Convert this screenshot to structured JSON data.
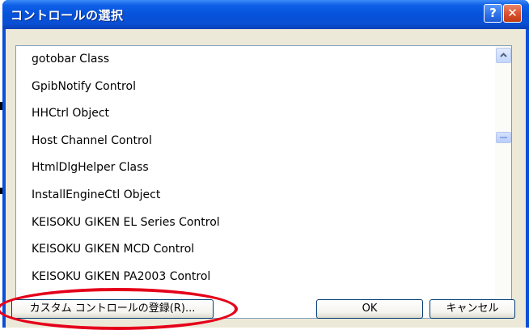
{
  "dialog": {
    "title": "コントロールの選択",
    "help_button": "?",
    "close_button": "✕"
  },
  "list": {
    "items": [
      "gotobar Class",
      "GpibNotify Control",
      "HHCtrl Object",
      "Host Channel Control",
      "HtmlDlgHelper Class",
      "InstallEngineCtl Object",
      "KEISOKU GIKEN EL Series Control",
      "KEISOKU GIKEN MCD Control",
      "KEISOKU GIKEN PA2003 Control",
      ""
    ]
  },
  "buttons": {
    "register_label": "カスタム コントロールの登録(R)...",
    "ok_label": "OK",
    "cancel_label": "キャンセル"
  },
  "icons": {
    "help": "help-icon",
    "close": "close-icon",
    "scroll_up": "chevron-up-icon",
    "scroll_down": "chevron-down-icon"
  },
  "colors": {
    "title_bar": "#0552d9",
    "close_button": "#d8502c",
    "dialog_face": "#ece9d8",
    "annotation_ellipse": "#e5001a"
  }
}
